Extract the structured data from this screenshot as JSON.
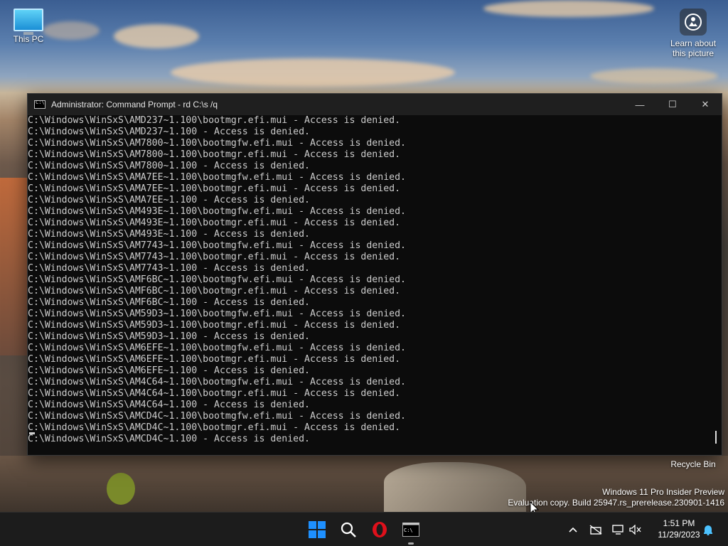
{
  "desktop": {
    "this_pc_label": "This PC",
    "learn_label_line1": "Learn about",
    "learn_label_line2": "this picture",
    "recycle_bin_label": "Recycle Bin",
    "watermark_line1": "Windows 11 Pro Insider Preview",
    "watermark_line2": "Evaluation copy. Build 25947.rs_prerelease.230901-1416"
  },
  "window": {
    "title": "Administrator: Command Prompt - rd  C:\\s /q",
    "minimize_symbol": "—",
    "maximize_symbol": "☐",
    "close_symbol": "✕"
  },
  "console_lines": [
    "C:\\Windows\\WinSxS\\AMD237~1.100\\bootmgr.efi.mui - Access is denied.",
    "C:\\Windows\\WinSxS\\AMD237~1.100 - Access is denied.",
    "C:\\Windows\\WinSxS\\AM7800~1.100\\bootmgfw.efi.mui - Access is denied.",
    "C:\\Windows\\WinSxS\\AM7800~1.100\\bootmgr.efi.mui - Access is denied.",
    "C:\\Windows\\WinSxS\\AM7800~1.100 - Access is denied.",
    "C:\\Windows\\WinSxS\\AMA7EE~1.100\\bootmgfw.efi.mui - Access is denied.",
    "C:\\Windows\\WinSxS\\AMA7EE~1.100\\bootmgr.efi.mui - Access is denied.",
    "C:\\Windows\\WinSxS\\AMA7EE~1.100 - Access is denied.",
    "C:\\Windows\\WinSxS\\AM493E~1.100\\bootmgfw.efi.mui - Access is denied.",
    "C:\\Windows\\WinSxS\\AM493E~1.100\\bootmgr.efi.mui - Access is denied.",
    "C:\\Windows\\WinSxS\\AM493E~1.100 - Access is denied.",
    "C:\\Windows\\WinSxS\\AM7743~1.100\\bootmgfw.efi.mui - Access is denied.",
    "C:\\Windows\\WinSxS\\AM7743~1.100\\bootmgr.efi.mui - Access is denied.",
    "C:\\Windows\\WinSxS\\AM7743~1.100 - Access is denied.",
    "C:\\Windows\\WinSxS\\AMF6BC~1.100\\bootmgfw.efi.mui - Access is denied.",
    "C:\\Windows\\WinSxS\\AMF6BC~1.100\\bootmgr.efi.mui - Access is denied.",
    "C:\\Windows\\WinSxS\\AMF6BC~1.100 - Access is denied.",
    "C:\\Windows\\WinSxS\\AM59D3~1.100\\bootmgfw.efi.mui - Access is denied.",
    "C:\\Windows\\WinSxS\\AM59D3~1.100\\bootmgr.efi.mui - Access is denied.",
    "C:\\Windows\\WinSxS\\AM59D3~1.100 - Access is denied.",
    "C:\\Windows\\WinSxS\\AM6EFE~1.100\\bootmgfw.efi.mui - Access is denied.",
    "C:\\Windows\\WinSxS\\AM6EFE~1.100\\bootmgr.efi.mui - Access is denied.",
    "C:\\Windows\\WinSxS\\AM6EFE~1.100 - Access is denied.",
    "C:\\Windows\\WinSxS\\AM4C64~1.100\\bootmgfw.efi.mui - Access is denied.",
    "C:\\Windows\\WinSxS\\AM4C64~1.100\\bootmgr.efi.mui - Access is denied.",
    "C:\\Windows\\WinSxS\\AM4C64~1.100 - Access is denied.",
    "C:\\Windows\\WinSxS\\AMCD4C~1.100\\bootmgfw.efi.mui - Access is denied.",
    "C:\\Windows\\WinSxS\\AMCD4C~1.100\\bootmgr.efi.mui - Access is denied.",
    "C:\\Windows\\WinSxS\\AMCD4C~1.100 - Access is denied."
  ],
  "taskbar": {
    "icons": [
      "windows-start-icon",
      "search-icon",
      "opera-icon",
      "terminal-icon"
    ],
    "tray_icons": [
      "chevron-up-icon",
      "network-off-icon",
      "display-icon",
      "volume-muted-icon",
      "notification-bell-icon"
    ],
    "time": "1:51 PM",
    "date": "11/29/2023"
  },
  "colors": {
    "console_bg": "#0c0c0c",
    "console_text": "#cccccc",
    "titlebar_bg": "#1f1f1f",
    "taskbar_bg": "#1c1c1c",
    "opera_red": "#e0101b",
    "start_blue": "#1e90ff"
  }
}
